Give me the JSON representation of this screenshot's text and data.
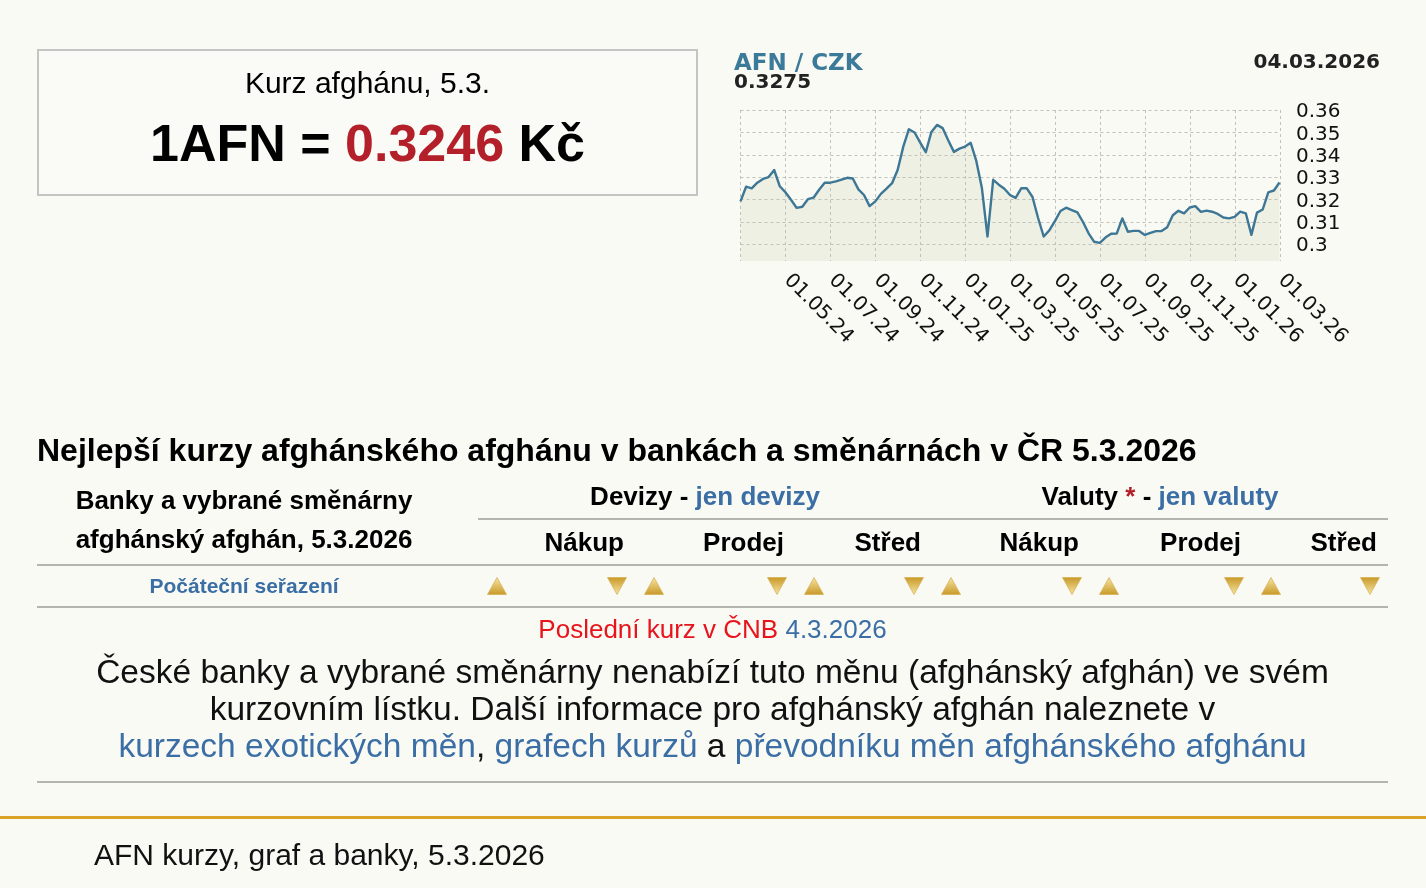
{
  "rate_box": {
    "title": "Kurz afghánu, 5.3.",
    "base": "1AFN",
    "equals": "=",
    "value": "0.3246",
    "currency": "Kč"
  },
  "chart": {
    "last_value": "0.3275",
    "date": "04.03.2026",
    "chart_data": {
      "type": "area",
      "title": "AFN / CZK",
      "grid": true,
      "categories": [
        null,
        null,
        null,
        null,
        null,
        null,
        null,
        null,
        "01.05.24",
        null,
        null,
        null,
        null,
        null,
        null,
        null,
        "01.07.24",
        null,
        null,
        null,
        null,
        null,
        null,
        null,
        "01.09.24",
        null,
        null,
        null,
        null,
        null,
        null,
        null,
        "01.11.24",
        null,
        null,
        null,
        null,
        null,
        null,
        null,
        "01.01.25",
        null,
        null,
        null,
        null,
        null,
        null,
        null,
        "01.03.25",
        null,
        null,
        null,
        null,
        null,
        null,
        null,
        "01.05.25",
        null,
        null,
        null,
        null,
        null,
        null,
        null,
        "01.07.25",
        null,
        null,
        null,
        null,
        null,
        null,
        null,
        "01.09.25",
        null,
        null,
        null,
        null,
        null,
        null,
        null,
        "01.11.25",
        null,
        null,
        null,
        null,
        null,
        null,
        null,
        "01.01.26",
        null,
        null,
        null,
        null,
        null,
        null,
        null,
        "01.03.26"
      ],
      "series": [
        {
          "color": "#3d7795",
          "values": [
            0.319,
            0.3256,
            0.3249,
            0.3274,
            0.3291,
            0.3299,
            0.3331,
            0.3258,
            0.3231,
            0.3198,
            0.3161,
            0.3166,
            0.32,
            0.3207,
            0.3242,
            0.3274,
            0.3274,
            0.328,
            0.3288,
            0.3296,
            0.3293,
            0.3244,
            0.3219,
            0.3169,
            0.319,
            0.3224,
            0.3247,
            0.3272,
            0.3332,
            0.3436,
            0.3514,
            0.3499,
            0.3454,
            0.3411,
            0.3502,
            0.3533,
            0.3519,
            0.3464,
            0.3412,
            0.3427,
            0.3436,
            0.3453,
            0.3372,
            0.325,
            0.3033,
            0.3287,
            0.3265,
            0.3247,
            0.3219,
            0.3206,
            0.3249,
            0.3249,
            0.321,
            0.3116,
            0.3033,
            0.306,
            0.3102,
            0.3147,
            0.3162,
            0.3151,
            0.3141,
            0.3098,
            0.3047,
            0.3009,
            0.3004,
            0.3028,
            0.3045,
            0.3046,
            0.3114,
            0.3054,
            0.3058,
            0.3058,
            0.304,
            0.3049,
            0.3057,
            0.3057,
            0.3074,
            0.3128,
            0.3148,
            0.3137,
            0.3163,
            0.3169,
            0.3143,
            0.3149,
            0.3144,
            0.3134,
            0.3118,
            0.3114,
            0.3121,
            0.3144,
            0.3137,
            0.304,
            0.314,
            0.3154,
            0.3231,
            0.3239,
            0.3275
          ]
        }
      ],
      "ylim": [
        0.2923,
        0.36
      ],
      "yticks": [
        0.3,
        0.31,
        0.32,
        0.33,
        0.34,
        0.35,
        0.36
      ]
    }
  },
  "banks": {
    "heading": "Nejlepší kurzy afghánského afghánu v bankách a směnárnách v ČR 5.3.2026",
    "bank_column": {
      "title": "Banky a vybrané směnárny",
      "subtitle": "afghánský afghán, 5.3.2026"
    },
    "groups": [
      {
        "label": "Devizy",
        "separator": "-",
        "link": "jen devizy",
        "columns": [
          "Nákup",
          "Prodej",
          "Střed"
        ]
      },
      {
        "label": "Valuty",
        "note_mark": "*",
        "separator": "-",
        "link": "jen valuty",
        "columns": [
          "Nákup",
          "Prodej",
          "Střed"
        ]
      }
    ],
    "sort_reset": "Počáteční seřazení",
    "cnb_note": {
      "text": "Poslední kurz v ČNB",
      "date": "4.3.2026"
    },
    "message": [
      {
        "kind": "text",
        "text": "České banky a vybrané směnárny nenabízí tuto měnu (afghánský afghán) ve svém kurzovním lístku. Další informace pro afghánský afghán naleznete v "
      },
      {
        "kind": "link",
        "text": "kurzech exotických měn"
      },
      {
        "kind": "text",
        "text": ", "
      },
      {
        "kind": "link",
        "text": "grafech kurzů"
      },
      {
        "kind": "text",
        "text": " a "
      },
      {
        "kind": "link",
        "text": "převodníku měn afghánského afghánu"
      }
    ]
  },
  "footer": {
    "text": "AFN kurzy, graf a banky, 5.3.2026"
  }
}
